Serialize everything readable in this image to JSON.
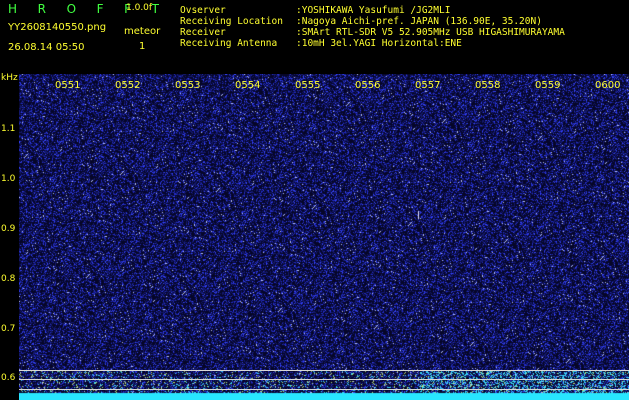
{
  "header": {
    "app_name": "H R O F F T",
    "version": "1.0.0f",
    "filename": "YY2608140550.png",
    "timestamp": "26.08.14 05:50",
    "meteor_label": "meteor",
    "meteor_count": "1"
  },
  "info": [
    {
      "key": "Ovserver",
      "value": ":YOSHIKAWA Yasufumi /JG2MLI"
    },
    {
      "key": "Receiving Location",
      "value": ":Nagoya Aichi-pref. JAPAN (136.90E, 35.20N)"
    },
    {
      "key": "Receiver",
      "value": ":SMArt RTL-SDR V5 52.905MHz USB HIGASHIMURAYAMA"
    },
    {
      "key": "Receiving Antenna",
      "value": ":10mH 3el.YAGI Horizontal:ENE"
    }
  ],
  "plot": {
    "y_unit": "kHz",
    "y_ticks": [
      "1.1",
      "1.0",
      "0.9",
      "0.8",
      "0.7",
      "0.6"
    ],
    "x_ticks": [
      "0551",
      "0552",
      "0553",
      "0554",
      "0555",
      "0556",
      "0557",
      "0558",
      "0559",
      "0600"
    ],
    "colors": {
      "background": "#06062a",
      "noise": "#2a3cff",
      "echo": "#e0e0ff",
      "trace": "#30ffff",
      "label": "#ffff30"
    }
  }
}
